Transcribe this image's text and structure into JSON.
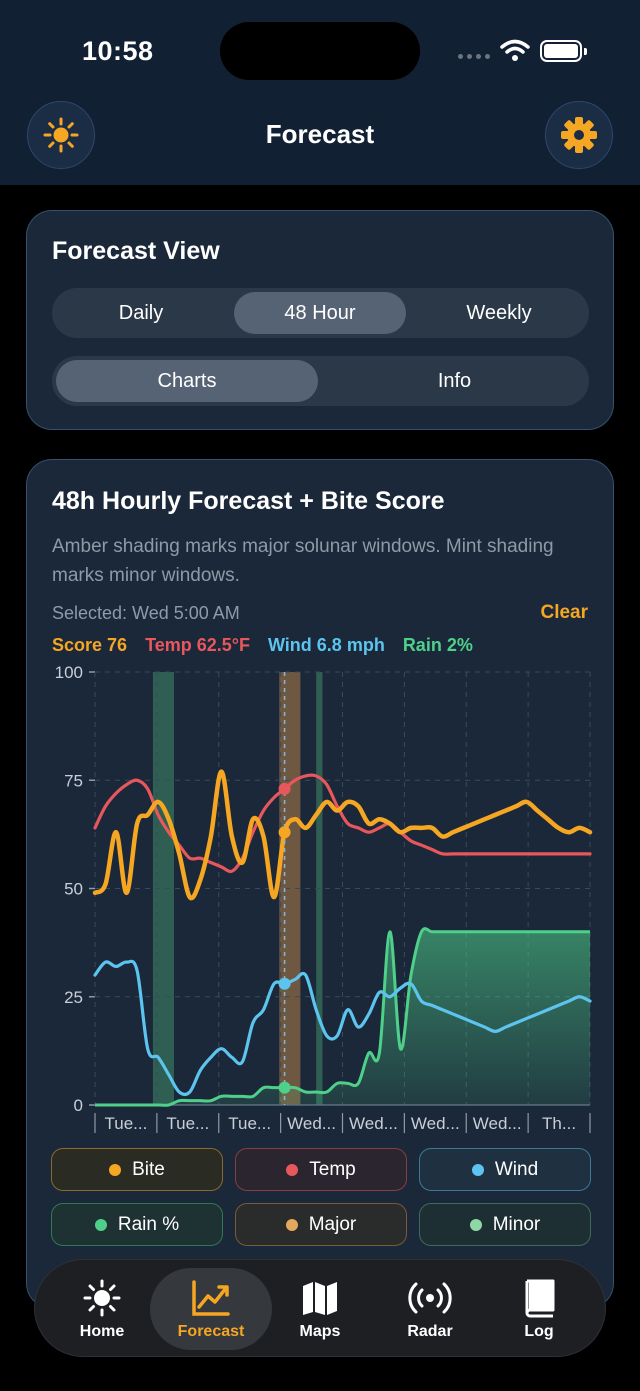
{
  "status": {
    "time": "10:58"
  },
  "header": {
    "title": "Forecast"
  },
  "forecast_view": {
    "title": "Forecast View",
    "ranges": [
      "Daily",
      "48 Hour",
      "Weekly"
    ],
    "selected_range": "48 Hour",
    "modes": [
      "Charts",
      "Info"
    ],
    "selected_mode": "Charts"
  },
  "chart_card": {
    "title": "48h Hourly Forecast + Bite Score",
    "subtitle": "Amber shading marks major solunar windows. Mint shading marks minor windows.",
    "selected": "Selected: Wed 5:00 AM",
    "clear": "Clear",
    "readouts": {
      "score": "Score 76",
      "temp": "Temp 62.5°F",
      "wind": "Wind 6.8 mph",
      "rain": "Rain 2%"
    }
  },
  "colors": {
    "accent": "#f5a623",
    "bite": "#f5a623",
    "temp": "#e8575c",
    "wind": "#5cc4ee",
    "rain": "#4fd08a",
    "major": "#a8784a",
    "minor": "#3f8a6a"
  },
  "chart_data": {
    "type": "line",
    "ylim": [
      0,
      100
    ],
    "yticks": [
      "100",
      "75",
      "50",
      "25",
      "0"
    ],
    "x_tick_labels": [
      "Tue...",
      "Tue...",
      "Tue...",
      "Wed...",
      "Wed...",
      "Wed...",
      "Wed...",
      "Th..."
    ],
    "x_hours": [
      0,
      1,
      2,
      3,
      4,
      5,
      6,
      7,
      8,
      9,
      10,
      11,
      12,
      13,
      14,
      15,
      16,
      17,
      18,
      19,
      20,
      21,
      22,
      23,
      24,
      25,
      26,
      27,
      28,
      29,
      30,
      31,
      32,
      33,
      34,
      35,
      36,
      37,
      38,
      39,
      40,
      41,
      42,
      43,
      44,
      45,
      46,
      47
    ],
    "selected_hour": 18,
    "major_windows": [
      [
        17.5,
        19.5
      ]
    ],
    "minor_windows": [
      [
        5.5,
        7.5
      ],
      [
        21,
        21.6
      ]
    ],
    "series": [
      {
        "name": "Bite",
        "values": [
          49,
          51,
          63,
          49,
          65,
          67,
          70,
          66,
          58,
          48,
          52,
          62,
          77,
          62,
          56,
          66,
          62,
          48,
          63,
          66,
          64,
          67,
          70,
          68,
          70,
          69,
          65,
          66,
          65,
          63,
          64,
          64,
          64,
          62,
          63,
          64,
          65,
          66,
          67,
          68,
          69,
          70,
          68,
          66,
          64,
          63,
          64,
          63
        ]
      },
      {
        "name": "Temp",
        "values": [
          64,
          69,
          72,
          74,
          75,
          73,
          67,
          63,
          60,
          57,
          57,
          56,
          55,
          54,
          57,
          63,
          68,
          71,
          73,
          75,
          76,
          76,
          74,
          69,
          65,
          64,
          63,
          64,
          65,
          63,
          61,
          60,
          59,
          58,
          58,
          58,
          58,
          58,
          58,
          58,
          58,
          58,
          58,
          58,
          58,
          58,
          58,
          58
        ]
      },
      {
        "name": "Wind",
        "values": [
          30,
          33,
          32,
          33,
          31,
          13,
          11,
          7,
          3,
          3,
          8,
          11,
          13,
          11,
          10,
          19,
          22,
          28,
          28,
          29,
          30,
          22,
          16,
          16,
          22,
          18,
          21,
          26,
          25,
          27,
          28,
          24,
          23,
          22,
          21,
          20,
          19,
          18,
          17,
          18,
          19,
          20,
          21,
          22,
          23,
          24,
          25,
          24
        ]
      },
      {
        "name": "Rain %",
        "values": [
          0,
          0,
          0,
          0,
          0,
          0,
          0,
          0,
          1,
          1,
          1,
          1,
          2,
          2,
          2,
          2,
          4,
          4,
          4,
          4,
          3,
          3,
          3,
          5,
          5,
          5,
          12,
          12,
          40,
          13,
          30,
          40,
          40,
          40,
          40,
          40,
          40,
          40,
          40,
          40,
          40,
          40,
          40,
          40,
          40,
          40,
          40,
          40
        ]
      }
    ],
    "legend": [
      {
        "label": "Bite",
        "color": "#f5a623",
        "type": "line"
      },
      {
        "label": "Temp",
        "color": "#e8575c",
        "type": "line"
      },
      {
        "label": "Wind",
        "color": "#5cc4ee",
        "type": "line"
      },
      {
        "label": "Rain %",
        "color": "#4fd08a",
        "type": "area"
      },
      {
        "label": "Major",
        "color": "#e3a85e",
        "type": "band"
      },
      {
        "label": "Minor",
        "color": "#8ed8a6",
        "type": "band"
      }
    ]
  },
  "tabs": [
    {
      "label": "Home",
      "icon": "sun-icon"
    },
    {
      "label": "Forecast",
      "icon": "chart-icon"
    },
    {
      "label": "Maps",
      "icon": "map-icon"
    },
    {
      "label": "Radar",
      "icon": "radar-icon"
    },
    {
      "label": "Log",
      "icon": "book-icon"
    }
  ],
  "active_tab": "Forecast"
}
